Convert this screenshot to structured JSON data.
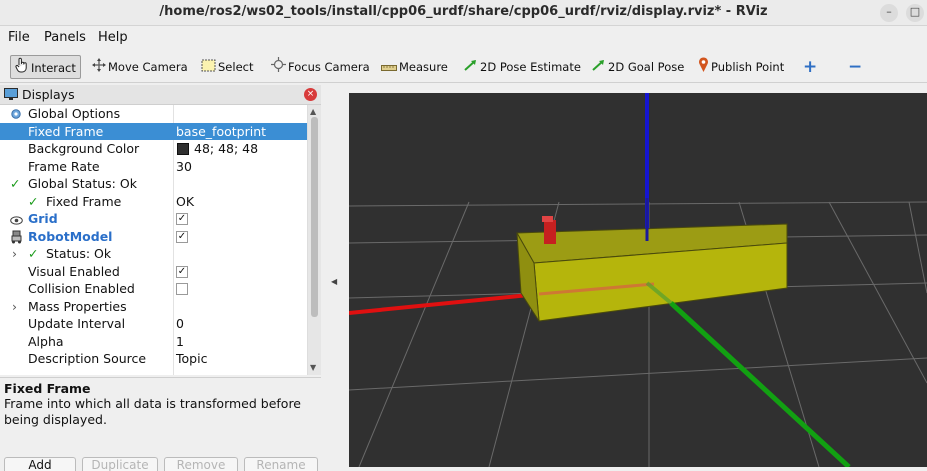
{
  "window": {
    "title": "/home/ros2/ws02_tools/install/cpp06_urdf/share/cpp06_urdf/rviz/display.rviz* - RViz",
    "minimize_glyph": "–",
    "maximize_glyph": "□"
  },
  "menu": {
    "file": "File",
    "panels": "Panels",
    "help": "Help"
  },
  "toolbar": {
    "interact": "Interact",
    "move_camera": "Move Camera",
    "select": "Select",
    "focus_camera": "Focus Camera",
    "measure": "Measure",
    "pose_estimate": "2D Pose Estimate",
    "goal_pose": "2D Goal Pose",
    "publish_point": "Publish Point",
    "add_tool": "+",
    "remove_tool": "−"
  },
  "displays_panel": {
    "title": "Displays",
    "close_glyph": "×",
    "rows": [
      {
        "name": "Global Options",
        "value": ""
      },
      {
        "name": "Fixed Frame",
        "value": "base_footprint"
      },
      {
        "name": "Background Color",
        "value": "48; 48; 48"
      },
      {
        "name": "Frame Rate",
        "value": "30"
      },
      {
        "name": "Global Status: Ok",
        "value": ""
      },
      {
        "name": "Fixed Frame",
        "value": "OK"
      },
      {
        "name": "Grid",
        "value": ""
      },
      {
        "name": "RobotModel",
        "value": ""
      },
      {
        "name": "Status: Ok",
        "value": ""
      },
      {
        "name": "Visual Enabled",
        "value": ""
      },
      {
        "name": "Collision Enabled",
        "value": ""
      },
      {
        "name": "Mass Properties",
        "value": ""
      },
      {
        "name": "Update Interval",
        "value": "0"
      },
      {
        "name": "Alpha",
        "value": "1"
      },
      {
        "name": "Description Source",
        "value": "Topic"
      }
    ],
    "checkmark": "✓",
    "expand_arrow": "›",
    "description_title": "Fixed Frame",
    "description_text": "Frame into which all data is transformed before being displayed.",
    "buttons": {
      "add": "Add",
      "duplicate": "Duplicate",
      "remove": "Remove",
      "rename": "Rename"
    }
  },
  "view3d": {
    "background_color": "#303030",
    "robot_color": "#b5b50c",
    "x_axis_color": "#e01010",
    "y_axis_color": "#12a012",
    "z_axis_color": "#1515d0",
    "marker_color": "#c62020"
  },
  "colors": {
    "selection": "#3b8ed4",
    "link": "#2a6fc9",
    "status_ok": "#1a9b1a"
  }
}
